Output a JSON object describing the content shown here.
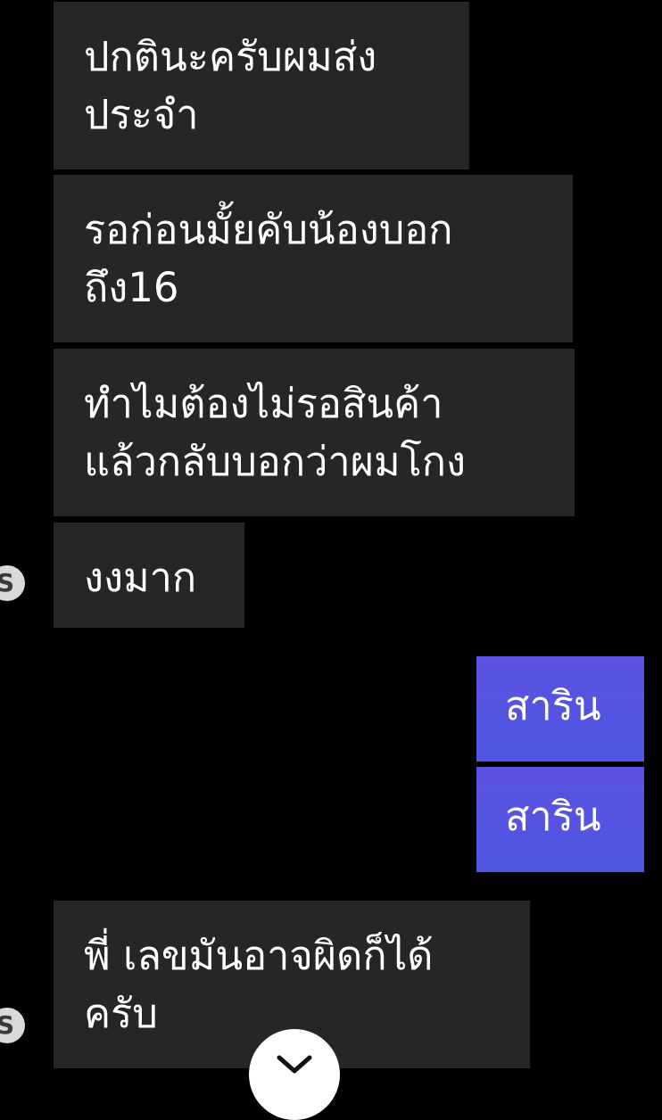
{
  "messages": [
    {
      "text": "ปกตินะครับผมส่ง\nประจำ"
    },
    {
      "text": "รอก่อนมั้ยคับน้องบอก\nถึง16"
    },
    {
      "text": "ทำไมต้องไม่รอสินค้า\nแล้วกลับบอกว่าผมโกง"
    },
    {
      "text": "งงมาก"
    },
    {
      "text": "สาริน"
    },
    {
      "text": "สาริน"
    },
    {
      "text": "พี่ เลขมันอาจผิดก็ได้\nครับ"
    }
  ],
  "colors": {
    "background": "#000000",
    "incoming_bubble": "#262626",
    "outgoing_bubble": "#5552e1",
    "text": "#ffffff"
  },
  "icons": {
    "avatar": "avatar",
    "scroll_down": "chevron-down-icon"
  }
}
